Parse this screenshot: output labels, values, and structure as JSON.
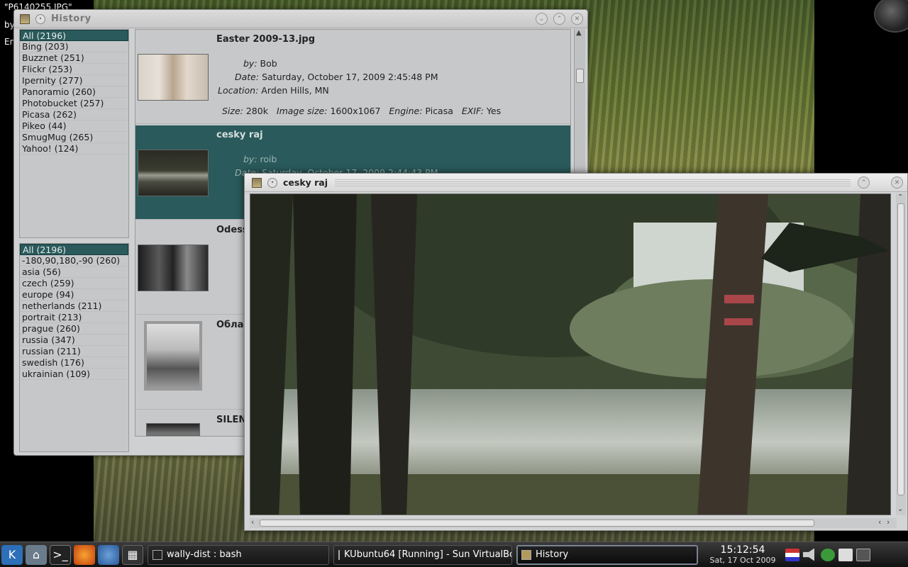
{
  "desktop": {
    "wallpaper_title": "\"P6140255.JPG\"",
    "wallpaper_by": "by",
    "wallpaper_en": "En"
  },
  "history_window": {
    "title": "History",
    "sources": [
      {
        "label": "All (2196)",
        "selected": true
      },
      {
        "label": "Bing (203)"
      },
      {
        "label": "Buzznet (251)"
      },
      {
        "label": "Flickr (253)"
      },
      {
        "label": "Ipernity (277)"
      },
      {
        "label": "Panoramio (260)"
      },
      {
        "label": "Photobucket (257)"
      },
      {
        "label": "Picasa (262)"
      },
      {
        "label": "Pikeo (44)"
      },
      {
        "label": "SmugMug (265)"
      },
      {
        "label": "Yahoo! (124)"
      }
    ],
    "tags": [
      {
        "label": "All (2196)",
        "selected": true
      },
      {
        "label": "-180,90,180,-90 (260)"
      },
      {
        "label": "asia (56)"
      },
      {
        "label": "czech (259)"
      },
      {
        "label": "europe (94)"
      },
      {
        "label": "netherlands (211)"
      },
      {
        "label": "portrait (213)"
      },
      {
        "label": "prague (260)"
      },
      {
        "label": "russia (347)"
      },
      {
        "label": "russian (211)"
      },
      {
        "label": "swedish (176)"
      },
      {
        "label": "ukrainian (109)"
      }
    ],
    "labels": {
      "by": "by:",
      "date": "Date:",
      "location": "Location:",
      "size": "Size:",
      "image_size": "Image size:",
      "engine": "Engine:",
      "exif": "EXIF:"
    },
    "entries": [
      {
        "title": "Easter 2009-13.jpg",
        "by": "Bob",
        "date": "Saturday, October 17, 2009 2:45:48 PM",
        "location": "Arden Hills, MN",
        "size": "280k",
        "image_size": "1600x1067",
        "engine": "Picasa",
        "exif": "Yes"
      },
      {
        "title": "cesky raj",
        "by": "roib",
        "date": "Saturday, October 17, 2009 2:44:43 PM"
      },
      {
        "title": "Odess"
      },
      {
        "title": "Облак"
      },
      {
        "title": "SILENT"
      }
    ]
  },
  "viewer_window": {
    "title": "cesky raj"
  },
  "taskbar": {
    "tasks": [
      {
        "label": "wally-dist : bash"
      },
      {
        "label": "KUbuntu64 [Running] - Sun VirtualBox"
      },
      {
        "label": "History",
        "active": true
      }
    ],
    "clock_time": "15:12:54",
    "clock_date": "Sat, 17 Oct 2009"
  }
}
